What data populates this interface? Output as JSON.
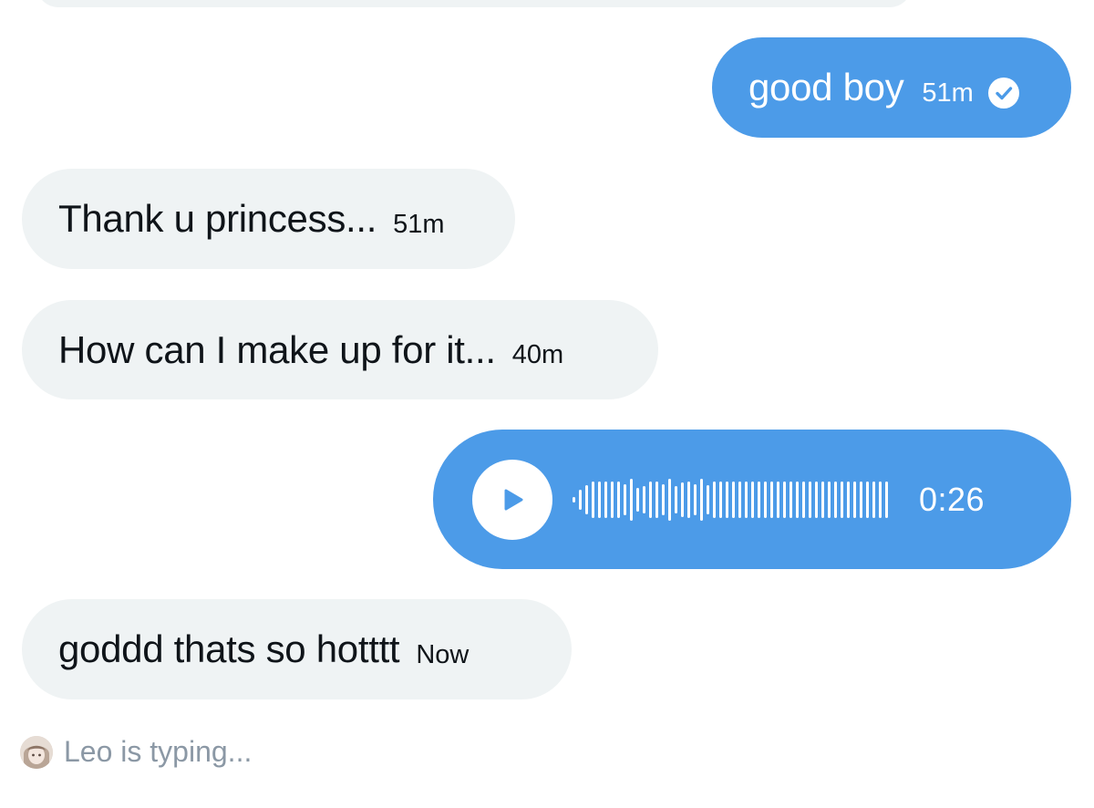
{
  "conversation": {
    "messages": [
      {
        "direction": "outgoing",
        "text": "good boy",
        "time": "51m",
        "status": "sent-check-icon"
      },
      {
        "direction": "incoming",
        "text": "Thank u princess...",
        "time": "51m"
      },
      {
        "direction": "incoming",
        "text": "How can I make up for it...",
        "time": "40m"
      },
      {
        "direction": "outgoing",
        "type": "voice",
        "duration": "0:26",
        "icon": "play-icon"
      },
      {
        "direction": "incoming",
        "text": "goddd thats so hotttt",
        "time": "Now"
      }
    ],
    "typing": {
      "text": "Leo is typing...",
      "avatar_icon": "avatar"
    }
  },
  "colors": {
    "outgoing_bubble": "#4c9be8",
    "incoming_bubble": "#eff3f4",
    "typing_text": "#8b98a5"
  }
}
